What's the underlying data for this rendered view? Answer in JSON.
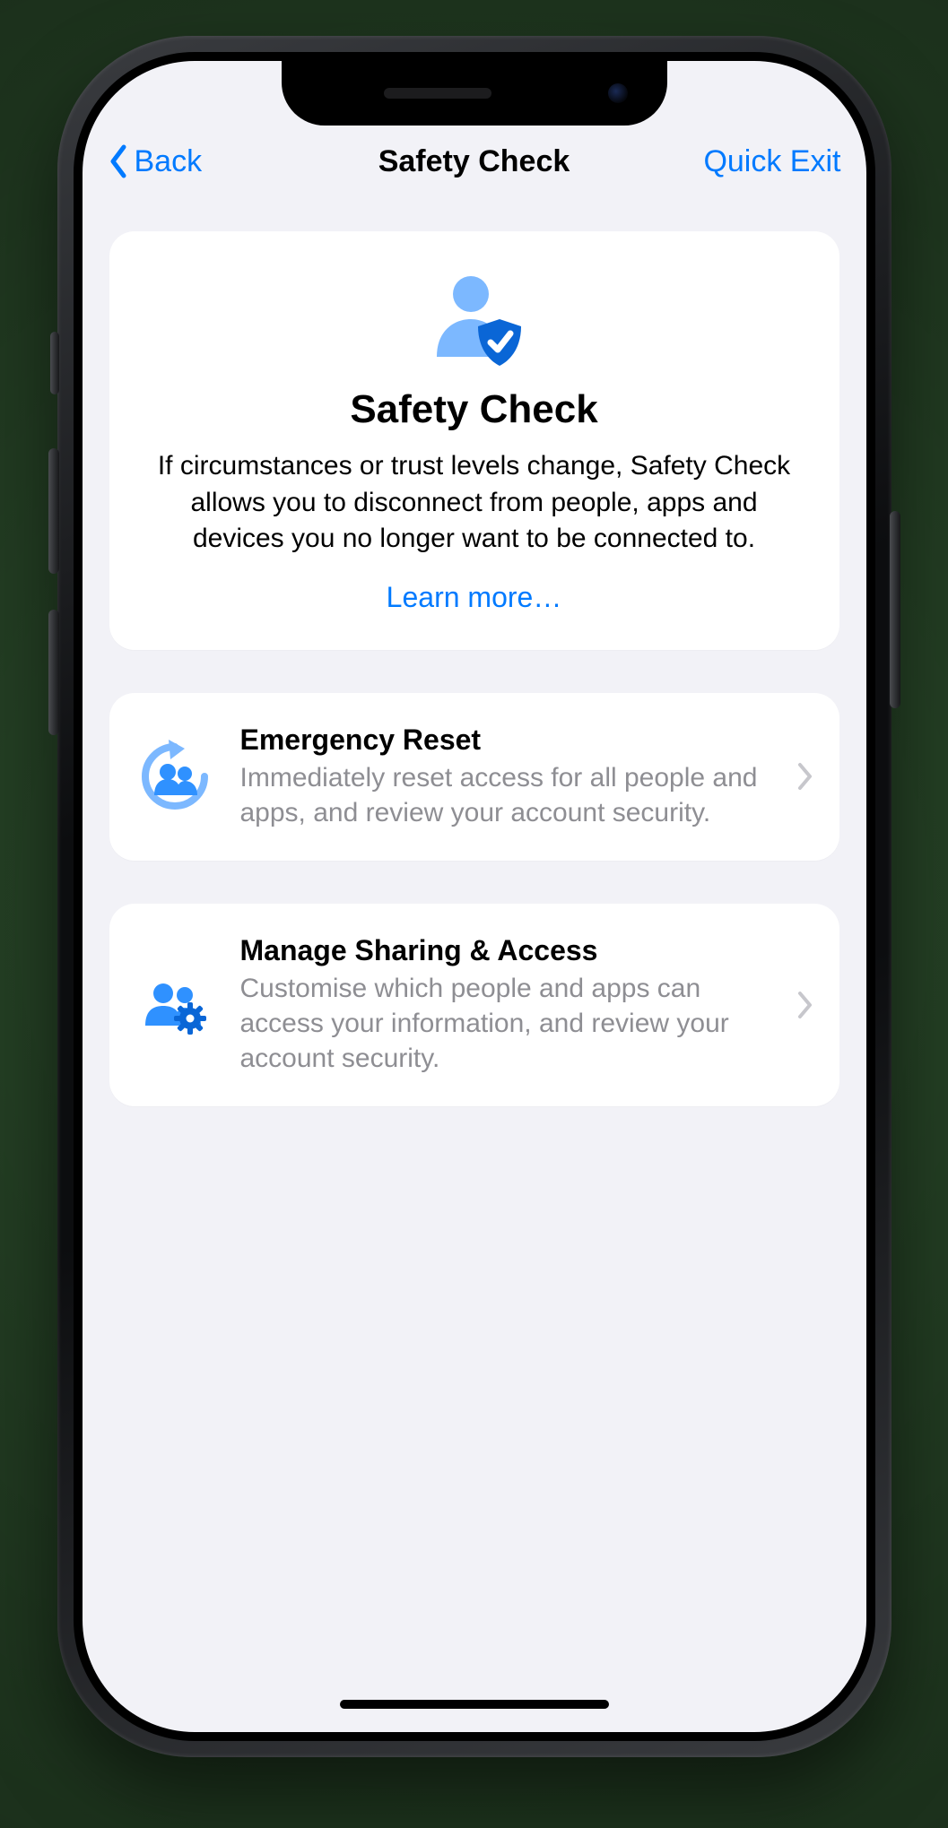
{
  "nav": {
    "back_label": "Back",
    "title": "Safety Check",
    "quick_exit_label": "Quick Exit"
  },
  "hero": {
    "title": "Safety Check",
    "description": "If circumstances or trust levels change, Safety Check allows you to disconnect from people, apps and devices you no longer want to be connected to.",
    "learn_more_label": "Learn more…"
  },
  "actions": [
    {
      "icon": "people-reset-icon",
      "title": "Emergency Reset",
      "description": "Immediately reset access for all people and apps, and review your account security."
    },
    {
      "icon": "people-gear-icon",
      "title": "Manage Sharing & Access",
      "description": "Customise which people and apps can access your information, and review your account security."
    }
  ],
  "colors": {
    "ios_blue": "#0a84ff",
    "ios_link": "#007aff",
    "screen_bg": "#f2f2f7",
    "card_bg": "#ffffff",
    "secondary_text": "#8e8e93"
  }
}
